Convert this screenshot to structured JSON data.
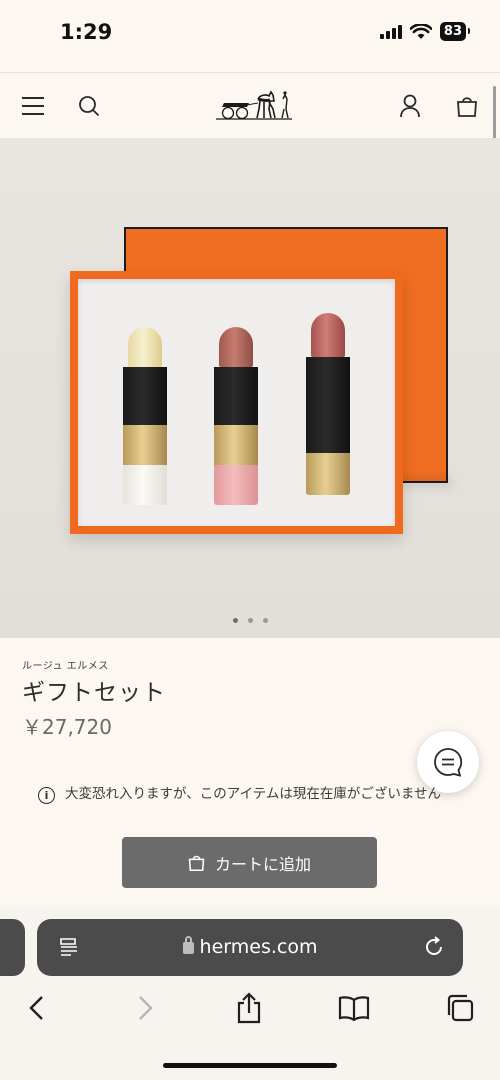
{
  "status_bar": {
    "time": "1:29",
    "battery": "83"
  },
  "header": {
    "menu_icon": "hamburger-menu-icon",
    "search_icon": "search-icon",
    "logo": "carriage-logo",
    "account_icon": "user-icon",
    "bag_icon": "shopping-bag-icon"
  },
  "carousel": {
    "slides": 3,
    "active_index": 0
  },
  "product": {
    "brand": "ルージュ エルメス",
    "title": "ギフトセット",
    "price": "￥27,720",
    "stock_message": "大変恐れ入りますが、このアイテムは現在在庫がございません",
    "cart_button": "カートに追加"
  },
  "lipsticks": [
    {
      "bullet": "#efe4b8",
      "base": "#f4f1ea"
    },
    {
      "bullet": "#b66d60",
      "base": "#ecabab"
    },
    {
      "bullet": "#c06a65",
      "base": "gold"
    }
  ],
  "browser": {
    "url": "hermes.com",
    "toolbar": [
      "back-icon",
      "forward-icon",
      "share-icon",
      "bookmarks-icon",
      "tabs-icon"
    ]
  },
  "colors": {
    "accent_orange": "#f06e22",
    "button_gray": "#6b6b6b",
    "background": "#fcf7f1"
  }
}
